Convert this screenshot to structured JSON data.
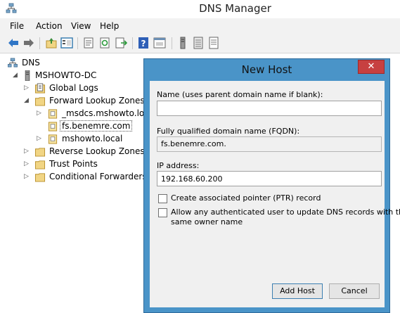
{
  "window": {
    "title": "DNS Manager"
  },
  "menu": [
    "File",
    "Action",
    "View",
    "Help"
  ],
  "toolbar_icons": [
    "back-arrow-icon",
    "forward-arrow-icon",
    "up-folder-icon",
    "show-hide-tree-icon",
    "properties-icon",
    "refresh-icon",
    "export-list-icon",
    "help-icon",
    "show-pane-icon",
    "server-icon",
    "zone-list-icon",
    "record-list-icon"
  ],
  "tree": {
    "root": "DNS",
    "server": "MSHOWTO-DC",
    "global_logs": "Global Logs",
    "forward_zones": "Forward Lookup Zones",
    "zone_msdcs": "_msdcs.mshowto.loc",
    "zone_fs": "fs.benemre.com",
    "zone_mshowto": "mshowto.local",
    "reverse_zones": "Reverse Lookup Zones",
    "trust_points": "Trust Points",
    "conditional_forwarders": "Conditional Forwarders"
  },
  "dialog": {
    "title": "New Host",
    "close_glyph": "✕",
    "name_label": "Name (uses parent domain name if blank):",
    "name_value": "",
    "fqdn_label": "Fully qualified domain name (FQDN):",
    "fqdn_value": "fs.benemre.com.",
    "ip_label": "IP address:",
    "ip_value": "192.168.60.200",
    "ptr_label": "Create associated pointer (PTR) record",
    "ptr_checked": false,
    "allow_label_line1": "Allow any authenticated user to update DNS records with the",
    "allow_label_line2": "same owner name",
    "allow_checked": false,
    "add_host_button": "Add Host",
    "cancel_button": "Cancel"
  },
  "colors": {
    "dialog_frame": "#4a94c8",
    "close_button": "#c74040",
    "folder": "#f1d584"
  }
}
